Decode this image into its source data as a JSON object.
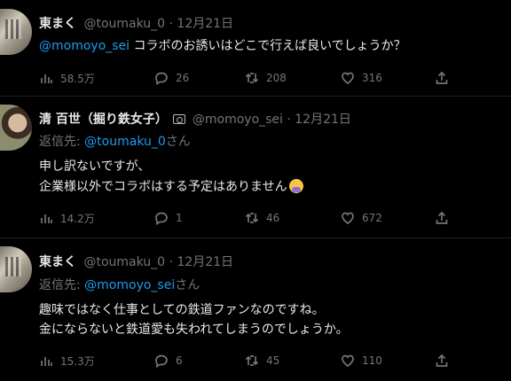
{
  "tweets": [
    {
      "name": "東まく",
      "handle": "@toumaku_0 · 12月21日",
      "mention": "@momoyo_sei",
      "text": " コラボのお誘いはどこで行えば良いでしょうか？",
      "views": "58.5万",
      "replies": "26",
      "retweets": "208",
      "likes": "316"
    },
    {
      "name": "清 百世（掘り鉄女子）",
      "handle": "@momoyo_sei · 12月21日",
      "reply_prefix": "返信先: ",
      "reply_handle": "@toumaku_0",
      "reply_suffix": "さん",
      "line1": "申し訳ないですが、",
      "line2": "企業様以外でコラボはする予定はありません",
      "views": "14.2万",
      "replies": "1",
      "retweets": "46",
      "likes": "672"
    },
    {
      "name": "東まく",
      "handle": "@toumaku_0 · 12月21日",
      "reply_prefix": "返信先: ",
      "reply_handle": "@momoyo_sei",
      "reply_suffix": "さん",
      "line1": "趣味ではなく仕事としての鉄道ファンなのですね。",
      "line2": "金にならないと鉄道愛も失われてしまうのでしょうか。",
      "views": "15.3万",
      "replies": "6",
      "retweets": "45",
      "likes": "110"
    }
  ]
}
